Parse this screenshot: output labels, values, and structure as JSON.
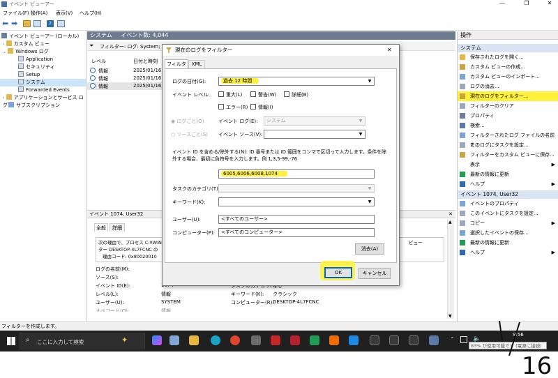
{
  "window": {
    "title": "イベント ビューアー"
  },
  "menu": [
    "ファイル(F)",
    "操作(A)",
    "表示(V)",
    "ヘルプ(H)"
  ],
  "tree": {
    "root": "イベント ビューアー (ローカル)",
    "custom": "カスタム ビュー",
    "windows_logs": "Windows ログ",
    "application": "Application",
    "security": "セキュリティ",
    "setup": "Setup",
    "system": "システム",
    "forwarded": "Forwarded Events",
    "apps_services": "アプリケーションとサービス ログ",
    "subscriptions": "サブスクリプション"
  },
  "center": {
    "header_name": "システム",
    "header_count": "イベント数: 4,044",
    "filter_text": "フィルター: ログ: System; ソース",
    "col_level": "レベル",
    "col_date": "日付と時刻",
    "rows": [
      {
        "level": "情報",
        "date": "2025/01/16"
      },
      {
        "level": "情報",
        "date": "2025/01/16"
      },
      {
        "level": "情報",
        "date": "2025/01/16"
      }
    ],
    "detail_header": "イベント 1074, User32",
    "tab_general": "全般",
    "tab_detail": "詳細",
    "desc_line1": "次の理由で、プロセス C:¥WIN",
    "desc_line2": "ター DESKTOP-4L7FCNC の",
    "desc_line3": "理由コード: 0x80020010",
    "desc_right": "ピュー",
    "props": {
      "logname_label": "ログの名前(M):",
      "source_label": "ソース(S):",
      "eventid_label": "イベント ID(E):",
      "eventid_value": "1074",
      "task_label": "タスクのカテゴリ(Y):",
      "task_value": "なし",
      "level_label": "レベル(L):",
      "level_value": "情報",
      "keyword_label": "キーワード(K):",
      "keyword_value": "クラシック",
      "user_label": "ユーザー(U):",
      "user_value": "SYSTEM",
      "computer_label": "コンピューター(R):",
      "computer_value": "DESKTOP-4L7FCNC",
      "opcode_label": "オペコード(O):",
      "opcode_value": "情報"
    }
  },
  "actions": {
    "heading": "操作",
    "section1": "システム",
    "items1": [
      "保存されたログを開く...",
      "カスタム ビューの作成...",
      "カスタム ビューのインポート...",
      "ログの消去...",
      "現在のログをフィルター...",
      "フィルターのクリア",
      "プロパティ",
      "検索...",
      "フィルターされたログ ファイルの名前を...",
      "このログにタスクを設定...",
      "フィルターをカスタム ビューに保存...",
      "表示",
      "最新の情報に更新",
      "ヘルプ"
    ],
    "section2": "イベント 1074, User32",
    "items2": [
      "イベントのプロパティ",
      "このイベントにタスクを設定...",
      "コピー",
      "選択したイベントの保存...",
      "最新の情報に更新",
      "ヘルプ"
    ]
  },
  "dialog": {
    "title": "現在のログをフィルター",
    "tab_filter": "フィルター",
    "tab_xml": "XML",
    "date_label": "ログの日付(G):",
    "date_value": "過去 12 時間",
    "level_label": "イベント レベル:",
    "lv_critical": "重大(L)",
    "lv_warning": "警告(W)",
    "lv_verbose": "詳細(B)",
    "lv_error": "エラー(R)",
    "lv_info": "情報(I)",
    "radio_bylog": "ログごと(O)",
    "radio_bysource": "ソースごと(S)",
    "eventlog_label": "イベント ログ(E):",
    "eventlog_value": "システム",
    "source_label": "イベント ソース(V):",
    "desc1": "イベント ID を含める/除外する(N): ID 番号または ID 範囲をコンマで区切って入力します。条件を除",
    "desc2": "外する場合、最初に負符号を入力します。例 1,3,5-99,-76",
    "eventid_value": "6005,6006,6008,1074",
    "task_label": "タスクのカテゴリ(T):",
    "keyword_label": "キーワード(K):",
    "user_label": "ユーザー(U):",
    "user_value": "<すべてのユーザー>",
    "computer_label": "コンピューター(P):",
    "computer_value": "<すべてのコンピューター>",
    "clear_btn": "消去(A)",
    "ok_btn": "OK",
    "cancel_btn": "キャンセル"
  },
  "status": "フィルターを作成します。",
  "taskbar": {
    "search": "ここに入力して検索",
    "time": "9:56",
    "battery": "83% が使用可能です (電源に接続)"
  },
  "annotation": "16"
}
